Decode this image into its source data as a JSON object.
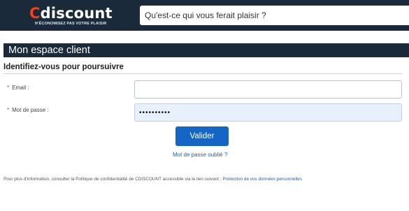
{
  "header": {
    "logo_brand": "Cdiscount",
    "logo_c": "C",
    "logo_rest": "discount",
    "logo_tagline": "N'ÉCONOMISEZ PAS VOTRE PLAISIR",
    "search_placeholder": "Qu'est-ce qui vous ferait plaisir ?"
  },
  "section": {
    "title": "Mon espace client"
  },
  "login": {
    "subtitle": "Identifiez-vous pour poursuivre",
    "required_marker": "*",
    "email_label": "Email :",
    "email_value": "",
    "password_label": "Mot de passe :",
    "password_value": "••••••••••",
    "submit_label": "Valider",
    "forgot_label": "Mot de passe oublié ?"
  },
  "footer": {
    "info_text": "Pour plus d'information, consulter la Politique de confidentialité de CDISCOUNT accessible via le lien suivant : ",
    "privacy_link": "Protection de vos données personnelles"
  },
  "colors": {
    "header_bg": "#1b2a3a",
    "logo_accent": "#ff3a14",
    "button_bg": "#1565c7",
    "link": "#1a5fb4",
    "required": "#e03a1a"
  }
}
